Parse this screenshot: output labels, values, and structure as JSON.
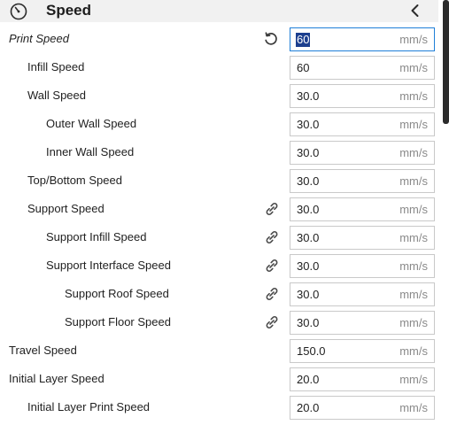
{
  "header": {
    "title": "Speed",
    "icon": "speedometer-icon",
    "collapse_icon": "chevron-left-icon"
  },
  "unit": "mm/s",
  "rows": [
    {
      "label": "Print Speed",
      "value": "60",
      "italic": true,
      "icon": "reset-icon",
      "active": true
    },
    {
      "label": "Infill Speed",
      "value": "60"
    },
    {
      "label": "Wall Speed",
      "value": "30.0"
    },
    {
      "label": "Outer Wall Speed",
      "value": "30.0"
    },
    {
      "label": "Inner Wall Speed",
      "value": "30.0"
    },
    {
      "label": "Top/Bottom Speed",
      "value": "30.0"
    },
    {
      "label": "Support Speed",
      "value": "30.0",
      "icon": "link-icon"
    },
    {
      "label": "Support Infill Speed",
      "value": "30.0",
      "icon": "link-icon"
    },
    {
      "label": "Support Interface Speed",
      "value": "30.0",
      "icon": "link-icon"
    },
    {
      "label": "Support Roof Speed",
      "value": "30.0",
      "icon": "link-icon"
    },
    {
      "label": "Support Floor Speed",
      "value": "30.0",
      "icon": "link-icon"
    },
    {
      "label": "Travel Speed",
      "value": "150.0"
    },
    {
      "label": "Initial Layer Speed",
      "value": "20.0"
    },
    {
      "label": "Initial Layer Print Speed",
      "value": "20.0"
    }
  ]
}
